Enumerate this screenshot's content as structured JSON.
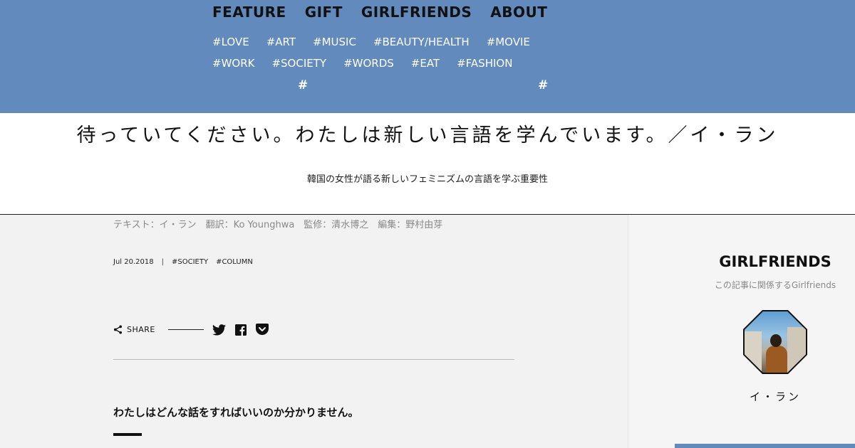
{
  "nav": {
    "main": [
      "FEATURE",
      "GIFT",
      "GIRLFRIENDS",
      "ABOUT"
    ],
    "tags_row1": [
      "#LOVE",
      "#ART",
      "#MUSIC",
      "#BEAUTY/HEALTH",
      "#MOVIE"
    ],
    "tags_row2": [
      "#WORK",
      "#SOCIETY",
      "#WORDS",
      "#EAT",
      "#FASHION"
    ],
    "stray_hash": "#"
  },
  "article": {
    "title": "待っていてください。わたしは新しい言語を学んでいます。／イ・ラン",
    "subtitle": "韓国の女性が語る新しいフェミニズムの言語を学ぶ重要性",
    "credits": "テキスト：イ・ラン　翻訳：Ko Younghwa　監修：清水博之　編集：野村由芽",
    "date": "Jul 20.2018",
    "separator": "|",
    "tags": [
      "#SOCIETY",
      "#COLUMN"
    ],
    "share_label": "SHARE",
    "lead": "わたしはどんな話をすればいいのか分かりません。"
  },
  "sidebar": {
    "heading": "GIRLFRIENDS",
    "subheading": "この記事に関係するGirlfriends",
    "person_name": "イ・ラン"
  },
  "colors": {
    "nav_bg": "#628abd",
    "page_bg": "#f2f2f2",
    "sidebar_bg": "#f5f5f5"
  }
}
